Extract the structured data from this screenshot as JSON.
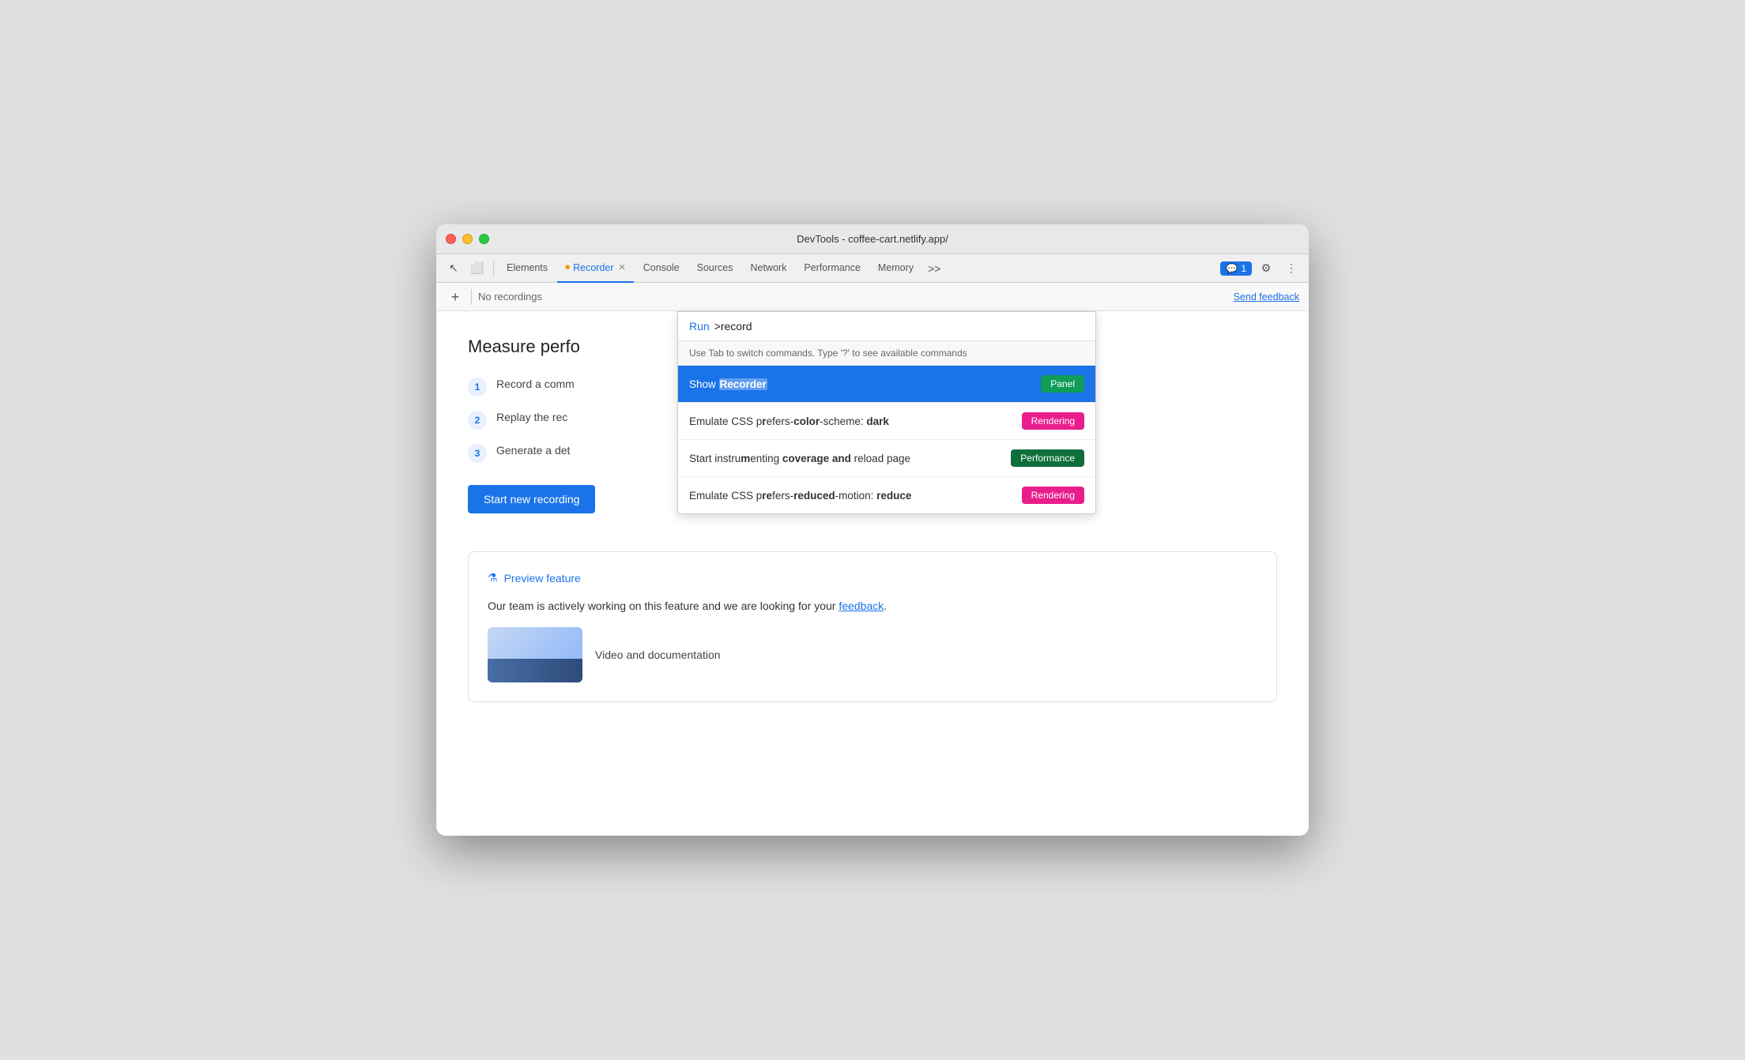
{
  "window": {
    "title": "DevTools - coffee-cart.netlify.app/"
  },
  "toolbar": {
    "tabs": [
      {
        "id": "elements",
        "label": "Elements",
        "active": false
      },
      {
        "id": "recorder",
        "label": "Recorder",
        "active": true,
        "hasIcon": true,
        "hasClose": true
      },
      {
        "id": "console",
        "label": "Console",
        "active": false
      },
      {
        "id": "sources",
        "label": "Sources",
        "active": false
      },
      {
        "id": "network",
        "label": "Network",
        "active": false
      },
      {
        "id": "performance",
        "label": "Performance",
        "active": false
      },
      {
        "id": "memory",
        "label": "Memory",
        "active": false
      }
    ],
    "feedback_badge": "1",
    "more_tabs_label": ">>"
  },
  "sub_toolbar": {
    "add_button_label": "+",
    "no_recordings": "No recordings",
    "send_feedback": "Send feedback"
  },
  "page": {
    "measure_title": "Measure perfo",
    "steps": [
      {
        "number": "1",
        "text": "Record a comm"
      },
      {
        "number": "2",
        "text": "Replay the rec"
      },
      {
        "number": "3",
        "text": "Generate a det"
      }
    ],
    "start_recording_btn": "Start new recording",
    "preview": {
      "flask_icon": "⚗",
      "header": "Preview feature",
      "body_text": "Our team is actively working on this feature and we are looking for your ",
      "feedback_link": "feedback",
      "body_suffix": ".",
      "video_doc_label": "Video and documentation"
    }
  },
  "command_palette": {
    "run_label": "Run",
    "input_value": ">record",
    "hint": "Use Tab to switch commands. Type '?' to see available commands",
    "items": [
      {
        "id": "show-recorder",
        "text_prefix": "Show ",
        "text_highlight": "Recorder",
        "text_suffix": "",
        "badge_label": "Panel",
        "badge_class": "badge-panel",
        "selected": true
      },
      {
        "id": "emulate-dark",
        "text_prefix": "Emulate CSS p",
        "text_bold1": "r",
        "text_mid1": "efers-",
        "text_bold2": "color",
        "text_mid2": "-scheme: ",
        "text_bold3": "dark",
        "text_suffix": "",
        "full_text": "Emulate CSS prefers-color-scheme: dark",
        "badge_label": "Rendering",
        "badge_class": "badge-rendering",
        "selected": false
      },
      {
        "id": "instrument-coverage",
        "full_text": "Start instrumenting coverage and reload page",
        "badge_label": "Performance",
        "badge_class": "badge-performance",
        "selected": false
      },
      {
        "id": "emulate-reduced-motion",
        "full_text": "Emulate CSS prefers-reduced-motion: reduce",
        "badge_label": "Rendering",
        "badge_class": "badge-rendering",
        "selected": false
      }
    ]
  },
  "icons": {
    "cursor": "↖",
    "inspect": "⬜",
    "flask": "⚗",
    "record_icon": "⏺",
    "settings": "⚙",
    "kebab": "⋮",
    "chat_bubble": "💬"
  }
}
